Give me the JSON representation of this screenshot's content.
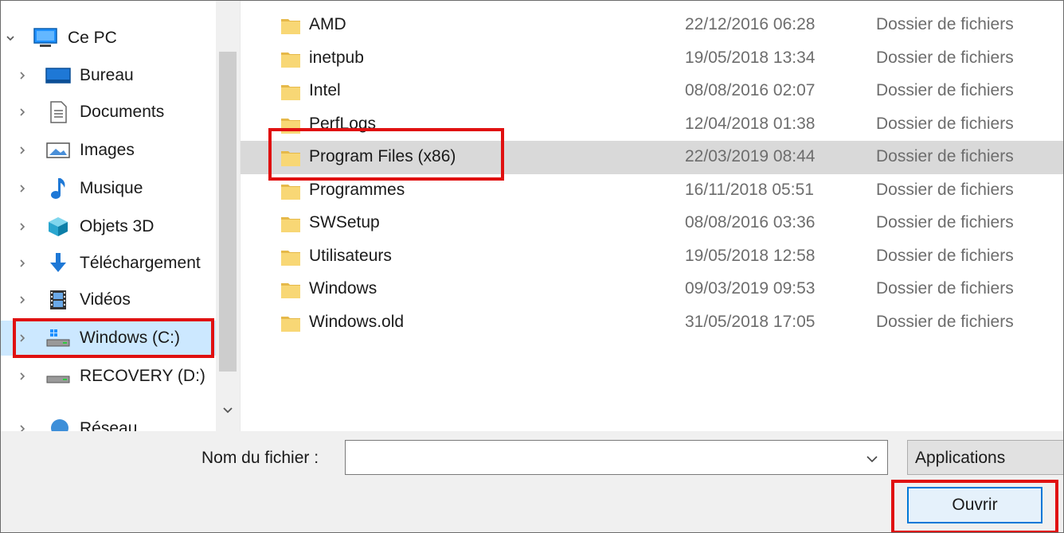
{
  "nav": {
    "items": [
      {
        "label": "Ce PC",
        "icon": "pc-icon",
        "chevron": "expanded"
      },
      {
        "label": "Bureau",
        "icon": "desktop-icon",
        "chevron": "collapsed"
      },
      {
        "label": "Documents",
        "icon": "documents-icon",
        "chevron": "collapsed"
      },
      {
        "label": "Images",
        "icon": "images-icon",
        "chevron": "collapsed"
      },
      {
        "label": "Musique",
        "icon": "music-icon",
        "chevron": "collapsed"
      },
      {
        "label": "Objets 3D",
        "icon": "objects-3d-icon",
        "chevron": "collapsed"
      },
      {
        "label": "Téléchargement",
        "icon": "download-icon",
        "chevron": "collapsed"
      },
      {
        "label": "Vidéos",
        "icon": "videos-icon",
        "chevron": "collapsed"
      },
      {
        "label": "Windows (C:)",
        "icon": "drive-c-icon",
        "chevron": "collapsed",
        "selected": true
      },
      {
        "label": "RECOVERY (D:)",
        "icon": "drive-d-icon",
        "chevron": "collapsed"
      },
      {
        "label": "Réseau",
        "icon": "network-icon",
        "chevron": "collapsed"
      }
    ]
  },
  "files": [
    {
      "name": "AMD",
      "date": "22/12/2016 06:28",
      "type": "Dossier de fichiers"
    },
    {
      "name": "inetpub",
      "date": "19/05/2018 13:34",
      "type": "Dossier de fichiers"
    },
    {
      "name": "Intel",
      "date": "08/08/2016 02:07",
      "type": "Dossier de fichiers"
    },
    {
      "name": "PerfLogs",
      "date": "12/04/2018 01:38",
      "type": "Dossier de fichiers"
    },
    {
      "name": "Program Files (x86)",
      "date": "22/03/2019 08:44",
      "type": "Dossier de fichiers",
      "selected": true
    },
    {
      "name": "Programmes",
      "date": "16/11/2018 05:51",
      "type": "Dossier de fichiers"
    },
    {
      "name": "SWSetup",
      "date": "08/08/2016 03:36",
      "type": "Dossier de fichiers"
    },
    {
      "name": "Utilisateurs",
      "date": "19/05/2018 12:58",
      "type": "Dossier de fichiers"
    },
    {
      "name": "Windows",
      "date": "09/03/2019 09:53",
      "type": "Dossier de fichiers"
    },
    {
      "name": "Windows.old",
      "date": "31/05/2018 17:05",
      "type": "Dossier de fichiers"
    }
  ],
  "bottom": {
    "filename_label": "Nom du fichier :",
    "filename_value": "",
    "filter_label": "Applications",
    "open_label": "Ouvrir"
  },
  "colors": {
    "highlight": "#e01010",
    "accent": "#0078d7",
    "folder": "#f8d775"
  }
}
